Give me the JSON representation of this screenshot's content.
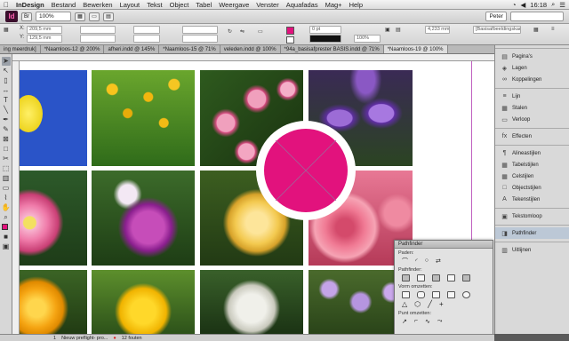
{
  "menubar": {
    "app_name": "InDesign",
    "items": [
      "Bestand",
      "Bewerken",
      "Layout",
      "Tekst",
      "Object",
      "Tabel",
      "Weergave",
      "Venster",
      "Aquafadas",
      "Mag+",
      "Help"
    ],
    "right": {
      "time": "16:18"
    }
  },
  "appbar": {
    "logo": "Id",
    "zoom": "100%",
    "user": "Peter"
  },
  "control": {
    "x_value": "209,5 mm",
    "y_value": "129,5 mm",
    "stroke_value": "0 pt",
    "percent_value": "100%",
    "dim_value": "4,233 mm",
    "style_value": "[Basisafbeeldingskader]+"
  },
  "tabs": [
    {
      "label": "ing meerdruk]"
    },
    {
      "label": "*Naamloos-12 @ 200%"
    },
    {
      "label": "afheri.indd @ 145%"
    },
    {
      "label": "*Naamloos-15 @ 71%"
    },
    {
      "label": "veleden.indd @ 100%"
    },
    {
      "label": "*94a_basisafprester BASIS.indd @ 71%"
    },
    {
      "label": "*Naamloos-19 @ 100%"
    }
  ],
  "tools": [
    "selection-icon",
    "direct-selection-icon",
    "page-icon",
    "gap-icon",
    "type-icon",
    "line-icon",
    "pen-icon",
    "pencil-icon",
    "rect-frame-icon",
    "rect-icon",
    "scissors-icon",
    "transform-icon",
    "gradient-icon",
    "note-icon",
    "eyedropper-icon",
    "hand-icon",
    "zoom-icon",
    "fill-stroke-icon",
    "view-mode-icon"
  ],
  "panels": [
    {
      "label": "Pagina's",
      "icon": "pages-icon",
      "glyph": "▤"
    },
    {
      "label": "Lagen",
      "icon": "layers-icon",
      "glyph": "◈"
    },
    {
      "label": "Koppelingen",
      "icon": "links-icon",
      "glyph": "∞"
    },
    {
      "label": "Lijn",
      "icon": "stroke-icon",
      "glyph": "≡"
    },
    {
      "label": "Stalen",
      "icon": "swatches-icon",
      "glyph": "▦"
    },
    {
      "label": "Verloop",
      "icon": "gradient-icon",
      "glyph": "▭"
    },
    {
      "label": "Effecten",
      "icon": "effects-icon",
      "glyph": "fx"
    },
    {
      "label": "Alineastijlen",
      "icon": "paragraph-styles-icon",
      "glyph": "¶"
    },
    {
      "label": "Tabelstijlen",
      "icon": "table-styles-icon",
      "glyph": "▦"
    },
    {
      "label": "Celstijlen",
      "icon": "cell-styles-icon",
      "glyph": "▦"
    },
    {
      "label": "Objectstijlen",
      "icon": "object-styles-icon",
      "glyph": "□"
    },
    {
      "label": "Tekenstijlen",
      "icon": "character-styles-icon",
      "glyph": "A"
    },
    {
      "label": "Tekstomloop",
      "icon": "text-wrap-icon",
      "glyph": "▣"
    },
    {
      "label": "Pathfinder",
      "icon": "pathfinder-icon",
      "glyph": "◨"
    },
    {
      "label": "Uitlijnen",
      "icon": "align-icon",
      "glyph": "▥"
    }
  ],
  "pathfinder": {
    "title": "Pathfinder",
    "sections": [
      "Paden:",
      "Pathfinder:",
      "Vorm omzetten:",
      "Punt omzetten:"
    ]
  },
  "status": {
    "page": "1",
    "preflight": "Nieuw preflight- pro...",
    "errors": "12 fouten"
  },
  "colors": {
    "accent_circle": "#e2127d",
    "circle_cross": "#9a6a9a"
  }
}
